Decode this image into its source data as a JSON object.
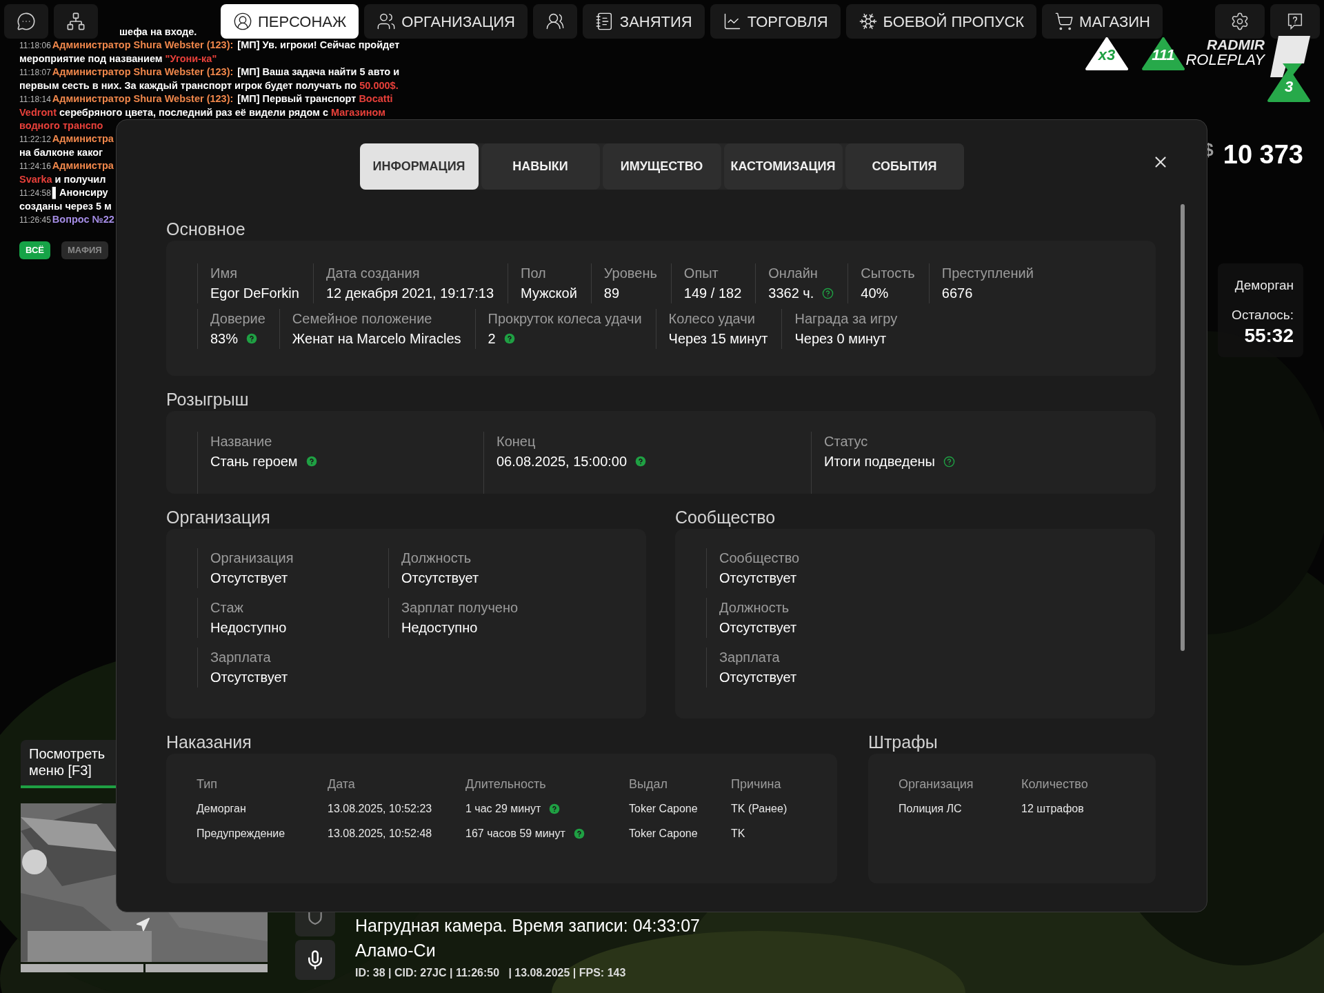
{
  "top_nav": {
    "left_buttons": [
      {
        "kind": "chat"
      },
      {
        "kind": "hierarchy"
      }
    ],
    "tabs": [
      {
        "label": "ПЕРСОНАЖ",
        "selected": true
      },
      {
        "label": "ОРГАНИЗАЦИЯ",
        "selected": false
      },
      {
        "selected": false
      },
      {
        "label": "ЗАНЯТИЯ",
        "selected": false
      },
      {
        "label": "ТОРГОВЛЯ",
        "selected": false
      },
      {
        "label": "БОЕВОЙ ПРОПУСК",
        "selected": false
      },
      {
        "label": "МАГАЗИН",
        "selected": false
      }
    ],
    "right_buttons": [
      {
        "kind": "settings"
      },
      {
        "kind": "help"
      }
    ]
  },
  "chat": {
    "lines": [
      [
        {
          "kind": "text",
          "text": "шефа на входе."
        }
      ],
      [
        {
          "kind": "time",
          "text": "11:18:06"
        },
        {
          "kind": "name",
          "text": "Администратор Shura Webster (123):"
        },
        {
          "kind": "text",
          "text": "[МП] Ув. игроки! Сейчас пройдет"
        }
      ],
      [
        {
          "kind": "text",
          "text": "мероприятие под названием "
        },
        {
          "kind": "accent",
          "text": "\"Угони-ка\""
        }
      ],
      [
        {
          "kind": "time",
          "text": "11:18:07"
        },
        {
          "kind": "name",
          "text": "Администратор Shura Webster (123):"
        },
        {
          "kind": "text",
          "text": "[МП] Ваша задача найти 5 авто и"
        }
      ],
      [
        {
          "kind": "text",
          "text": "первым сесть в них. За каждый транспорт игрок будет получать по "
        },
        {
          "kind": "accent",
          "text": "50.000$."
        }
      ],
      [
        {
          "kind": "time",
          "text": "11:18:14"
        },
        {
          "kind": "name",
          "text": "Администратор Shura Webster (123):"
        },
        {
          "kind": "text",
          "text": "[МП] Первый транспорт "
        },
        {
          "kind": "accent",
          "text": "Bocatti"
        }
      ],
      [
        {
          "kind": "accent",
          "text": "Vedront"
        },
        {
          "kind": "text",
          "text": " серебряного цвета, последний раз её видели рядом с "
        },
        {
          "kind": "accent",
          "text": "Магазином"
        }
      ],
      [
        {
          "kind": "accent",
          "text": "водного транспо"
        }
      ],
      [
        {
          "kind": "time",
          "text": "11:22:12"
        },
        {
          "kind": "name",
          "text": "Администра"
        }
      ],
      [
        {
          "kind": "text",
          "text": "на балконе каког"
        }
      ],
      [
        {
          "kind": "time",
          "text": "11:24:16"
        },
        {
          "kind": "name",
          "text": "Администра"
        }
      ],
      [
        {
          "kind": "accent",
          "text": "Svarka"
        },
        {
          "kind": "text",
          "text": " и получил"
        }
      ],
      [
        {
          "kind": "time",
          "text": "11:24:58"
        },
        {
          "kind": "text",
          "text": "▌Анонсиру"
        }
      ],
      [
        {
          "kind": "text",
          "text": "созданы через 5 м"
        }
      ],
      [
        {
          "kind": "time",
          "text": "11:26:45"
        },
        {
          "kind": "question",
          "text": "Вопрос №22"
        }
      ]
    ],
    "filters": [
      {
        "label": "ВСЁ",
        "selected": true
      },
      {
        "label": "МАФИЯ",
        "selected": false
      }
    ]
  },
  "logo": {
    "top": "RADMIR",
    "bottom": "ROLEPLAY",
    "badges": [
      {
        "kind": "light",
        "text": "x3"
      },
      {
        "kind": "online",
        "text": "111"
      },
      {
        "kind": "level",
        "text": "3"
      }
    ]
  },
  "money": {
    "symbol": "$",
    "amount": "10 373"
  },
  "jail": {
    "title": "Деморган",
    "label": "Осталось:",
    "time": "55:32"
  },
  "modal": {
    "tabs": [
      {
        "label": "ИНФОРМАЦИЯ",
        "selected": true
      },
      {
        "label": "НАВЫКИ",
        "selected": false
      },
      {
        "label": "ИМУЩЕСТВО",
        "selected": false
      },
      {
        "label": "КАСТОМИЗАЦИЯ",
        "selected": false
      },
      {
        "label": "СОБЫТИЯ",
        "selected": false
      }
    ],
    "basic": {
      "title": "Основное",
      "rows": [
        {
          "fields": [
            {
              "label": "Имя",
              "value": "Egor DeForkin"
            },
            {
              "label": "Дата создания",
              "value": "12 декабря 2021, 19:17:13"
            },
            {
              "label": "Пол",
              "value": "Мужской"
            },
            {
              "label": "Уровень",
              "value": "89"
            },
            {
              "label": "Опыт",
              "value": "149 / 182"
            },
            {
              "label": "Онлайн",
              "value": "3362 ч.",
              "help_filled": false
            },
            {
              "label": "Сытость",
              "value": "40%"
            },
            {
              "label": "Преступлений",
              "value": "6676"
            }
          ]
        },
        {
          "fields": [
            {
              "label": "Доверие",
              "value": "83%",
              "help_filled": true
            },
            {
              "label": "Семейное положение",
              "value": "Женат на Marcelo Miracles"
            },
            {
              "label": "Прокруток колеса удачи",
              "value": "2",
              "help_filled": true
            },
            {
              "label": "Колесо удачи",
              "value": "Через 15 минут"
            },
            {
              "label": "Награда за игру",
              "value": "Через 0 минут"
            }
          ]
        }
      ]
    },
    "giveaway": {
      "title": "Розыгрыш",
      "fields": [
        {
          "label": "Название",
          "value": "Стань героем",
          "help_filled": true
        },
        {
          "label": "Конец",
          "value": "06.08.2025, 15:00:00",
          "help_filled": true
        },
        {
          "label": "Статус",
          "value": "Итоги подведены",
          "help_filled": false
        }
      ]
    },
    "organization": {
      "title": "Организация",
      "fields": [
        {
          "label": "Организация",
          "value": "Отсутствует"
        },
        {
          "label": "Должность",
          "value": "Отсутствует"
        },
        {
          "label": "Стаж",
          "value": "Недоступно"
        },
        {
          "label": "Зарплат получено",
          "value": "Недоступно"
        },
        {
          "label": "Зарплата",
          "value": "Отсутствует"
        }
      ]
    },
    "community": {
      "title": "Сообщество",
      "fields": [
        {
          "label": "Сообщество",
          "value": "Отсутствует"
        },
        {
          "label": "Должность",
          "value": "Отсутствует"
        },
        {
          "label": "Зарплата",
          "value": "Отсутствует"
        }
      ]
    },
    "punishments": {
      "title": "Наказания",
      "columns": [
        "Тип",
        "Дата",
        "Длительность",
        "Выдал",
        "Причина"
      ],
      "rows": [
        {
          "cells": [
            "Деморган",
            "13.08.2025, 10:52:23",
            "1 час 29 минут",
            "Toker Capone",
            "TK (Ранее)"
          ],
          "help_filled": true
        },
        {
          "cells": [
            "Предупреждение",
            "13.08.2025, 10:52:48",
            "167 часов 59 минут",
            "Toker Capone",
            "TK"
          ],
          "help_filled": true
        }
      ]
    },
    "fines": {
      "title": "Штрафы",
      "columns": [
        "Организация",
        "Количество"
      ],
      "rows": [
        [
          "Полиция ЛС",
          "12 штрафов"
        ]
      ]
    }
  },
  "question_hint": {
    "lines": [
      "Посмотреть",
      "меню [F3]"
    ]
  },
  "status": {
    "camera": "Нагрудная камера. Время записи: 04:33:07",
    "location": "Аламо-Си",
    "info": "ID: 38 | CID: 27JC | 11:26:50   | 13.08.2025 | FPS: 143"
  }
}
